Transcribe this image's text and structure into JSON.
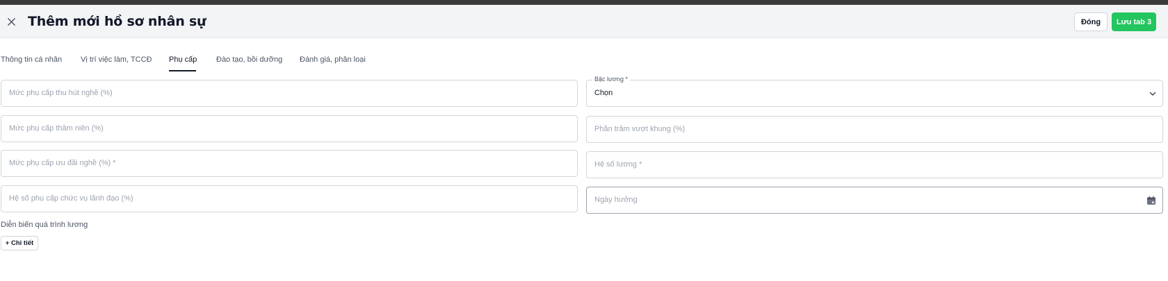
{
  "header": {
    "title": "Thêm mới hồ sơ nhân sự",
    "close_icon": "close-icon",
    "close_button_label": "Đóng",
    "save_button_label": "Lưu tab 3",
    "save_button_color": "#22c55e"
  },
  "tabs": [
    {
      "label": "Thông tin cá nhân",
      "active": false
    },
    {
      "label": "Vị trí việc làm, TCCĐ",
      "active": false
    },
    {
      "label": "Phụ cấp",
      "active": true
    },
    {
      "label": "Đào tạo, bồi dưỡng",
      "active": false
    },
    {
      "label": "Đánh giá, phân loại",
      "active": false
    }
  ],
  "form": {
    "left": [
      {
        "placeholder": "Mức phụ cấp thu hút nghề (%)"
      },
      {
        "placeholder": "Mức phụ cấp thâm niên (%)"
      },
      {
        "placeholder": "Mức phụ cấp ưu đãi nghề (%) *"
      },
      {
        "placeholder": "Hệ số phụ cấp chức vụ lãnh đạo (%)"
      }
    ],
    "right": {
      "salary_grade": {
        "label": "Bậc lương *",
        "value": "Chọn",
        "icon": "chevron-down-icon"
      },
      "over_frame_percent": {
        "placeholder": "Phần trăm vượt khung (%)"
      },
      "salary_coefficient": {
        "placeholder": "Hệ số lương *"
      },
      "effective_date": {
        "placeholder": "Ngày hưởng",
        "icon": "calendar-icon"
      }
    }
  },
  "salary_history": {
    "label": "Diễn biến quá trình lương",
    "detail_button_label": "+ Chi tiết"
  }
}
